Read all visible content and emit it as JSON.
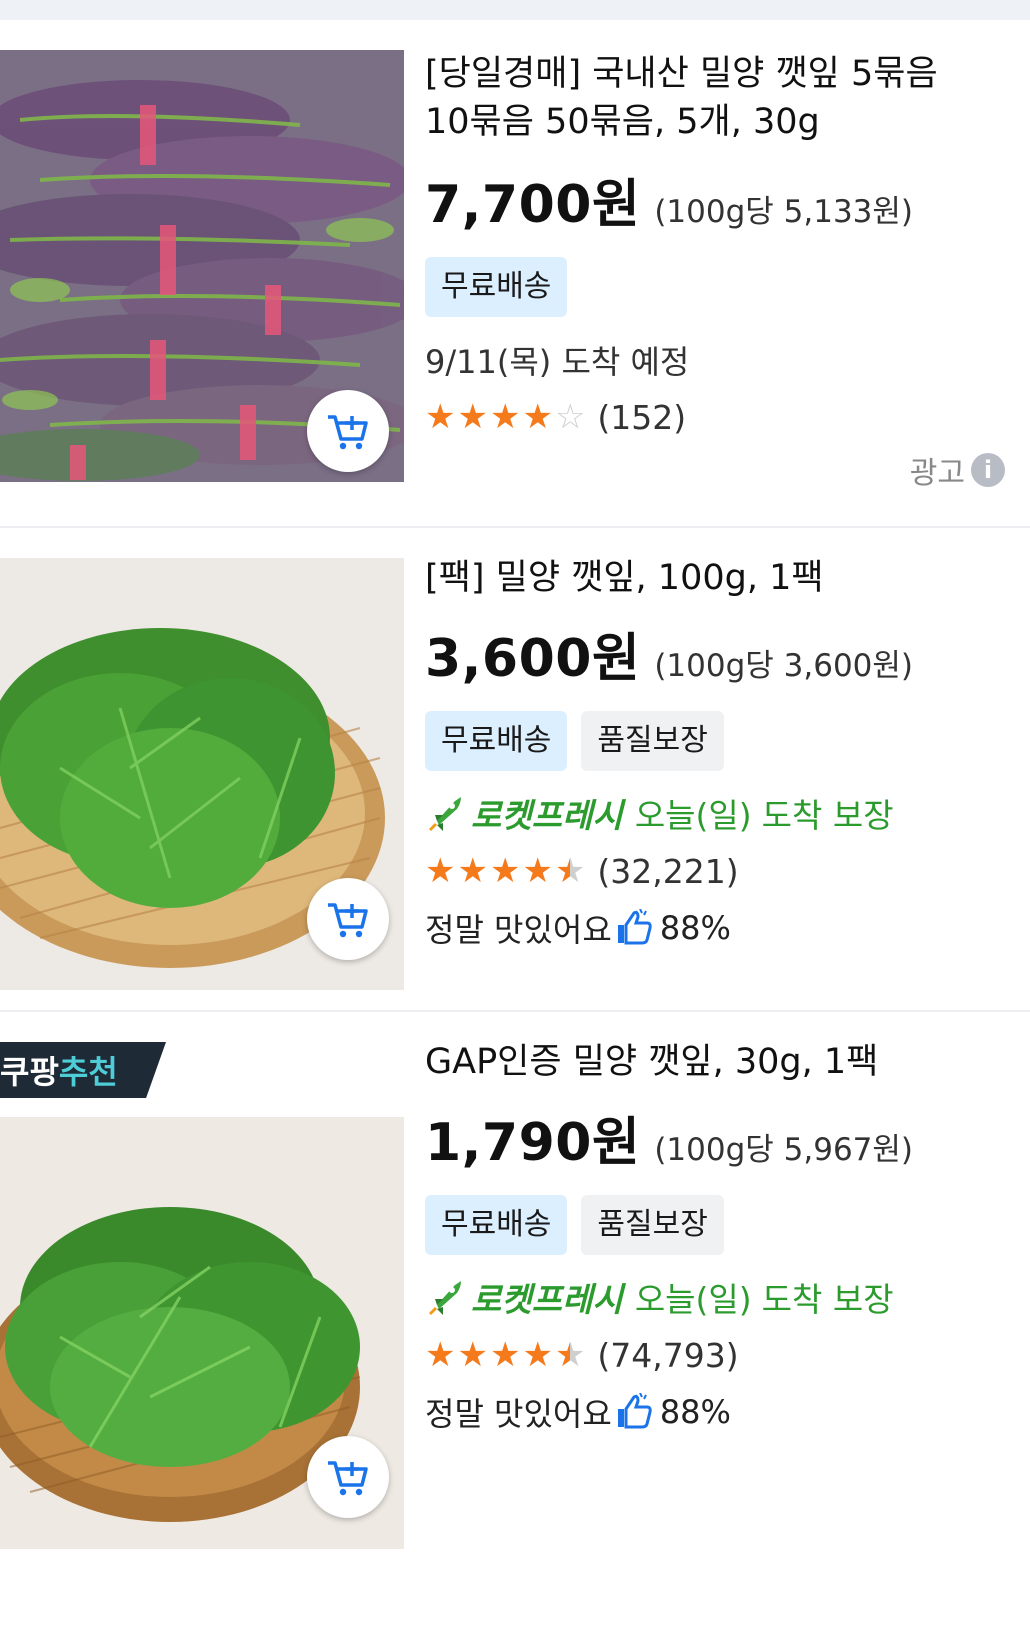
{
  "products": [
    {
      "title": "[당일경매] 국내산 밀양 깻잎 5묶음 10묶음 50묶음, 5개, 30g",
      "title_line1": "[당일경매] 국내산 밀양 깻잎 5묶음",
      "title_line2": "10묶음 50묶음, 5개, 30g",
      "price": "7,700원",
      "unit_price": "(100g당 5,133원)",
      "badges": [
        "무료배송"
      ],
      "arrival": "9/11(목) 도착 예정",
      "rating": 4,
      "reviews": "(152)",
      "ad_label": "광고",
      "image": "red-perilla-leaves-bundles"
    },
    {
      "title": "[팩] 밀양 깻잎, 100g, 1팩",
      "price": "3,600원",
      "unit_price": "(100g당 3,600원)",
      "badges": [
        "무료배송",
        "품질보장"
      ],
      "rocket_name": "로켓프레시",
      "rocket_day": "오늘(일)",
      "rocket_guarantee": "도착 보장",
      "rating": 4.5,
      "reviews": "(32,221)",
      "taste_label": "정말 맛있어요",
      "taste_pct": "88%",
      "image": "perilla-leaves-basket"
    },
    {
      "banner_prefix": "쿠팡",
      "banner_highlight": "추천",
      "title": "GAP인증 밀양 깻잎, 30g, 1팩",
      "price": "1,790원",
      "unit_price": "(100g당 5,967원)",
      "badges": [
        "무료배송",
        "품질보장"
      ],
      "rocket_name": "로켓프레시",
      "rocket_day": "오늘(일)",
      "rocket_guarantee": "도착 보장",
      "rating": 4.5,
      "reviews": "(74,793)",
      "taste_label": "정말 맛있어요",
      "taste_pct": "88%",
      "image": "perilla-leaves-basket"
    }
  ],
  "icons": {
    "cart": "add-to-cart-icon",
    "rocket": "rocket-icon",
    "thumbs_up": "thumbs-up-icon",
    "info": "info-icon"
  },
  "colors": {
    "price": "#111111",
    "free_shipping_bg": "#dcefff",
    "rocket_green": "#2c9b2e",
    "star_orange": "#f47a1c",
    "banner_dark": "#1f2a37",
    "banner_highlight": "#4ecdd6"
  }
}
